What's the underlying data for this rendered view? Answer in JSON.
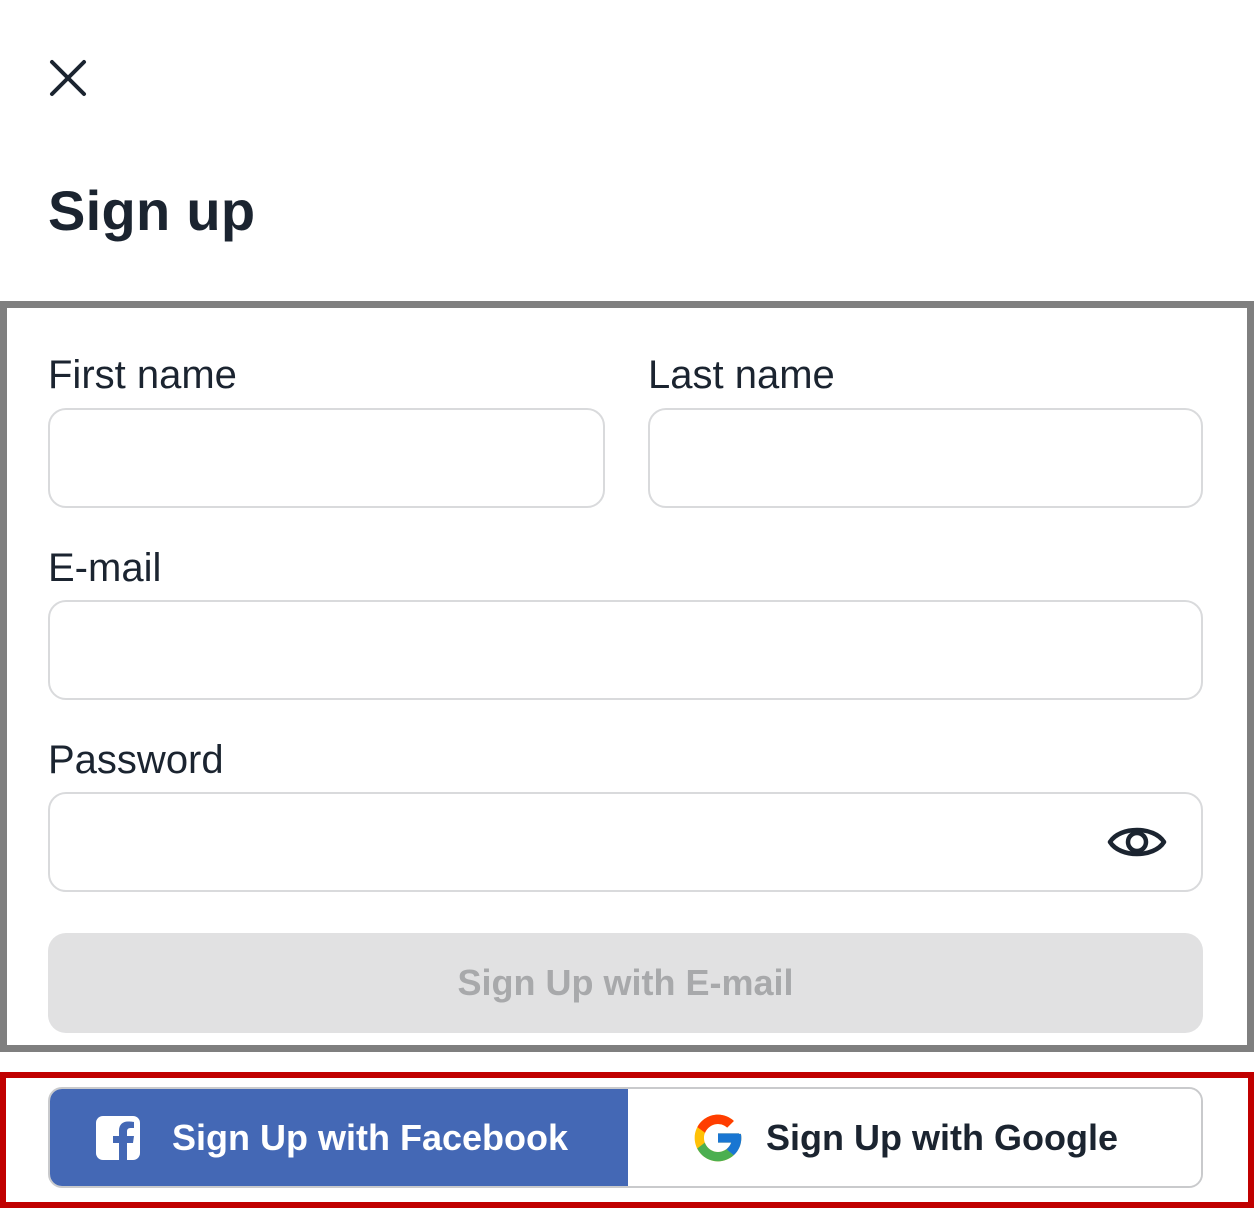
{
  "header": {
    "close_icon": "close-icon",
    "title": "Sign up"
  },
  "form": {
    "first_name": {
      "label": "First name",
      "value": "",
      "placeholder": ""
    },
    "last_name": {
      "label": "Last name",
      "value": "",
      "placeholder": ""
    },
    "email": {
      "label": "E-mail",
      "value": "",
      "placeholder": ""
    },
    "password": {
      "label": "Password",
      "value": "",
      "placeholder": "",
      "toggle_icon": "eye-icon"
    },
    "submit_label": "Sign Up with E-mail",
    "submit_enabled": false
  },
  "social": {
    "facebook_label": "Sign Up with Facebook",
    "google_label": "Sign Up with Google",
    "facebook_color": "#4468b5"
  }
}
